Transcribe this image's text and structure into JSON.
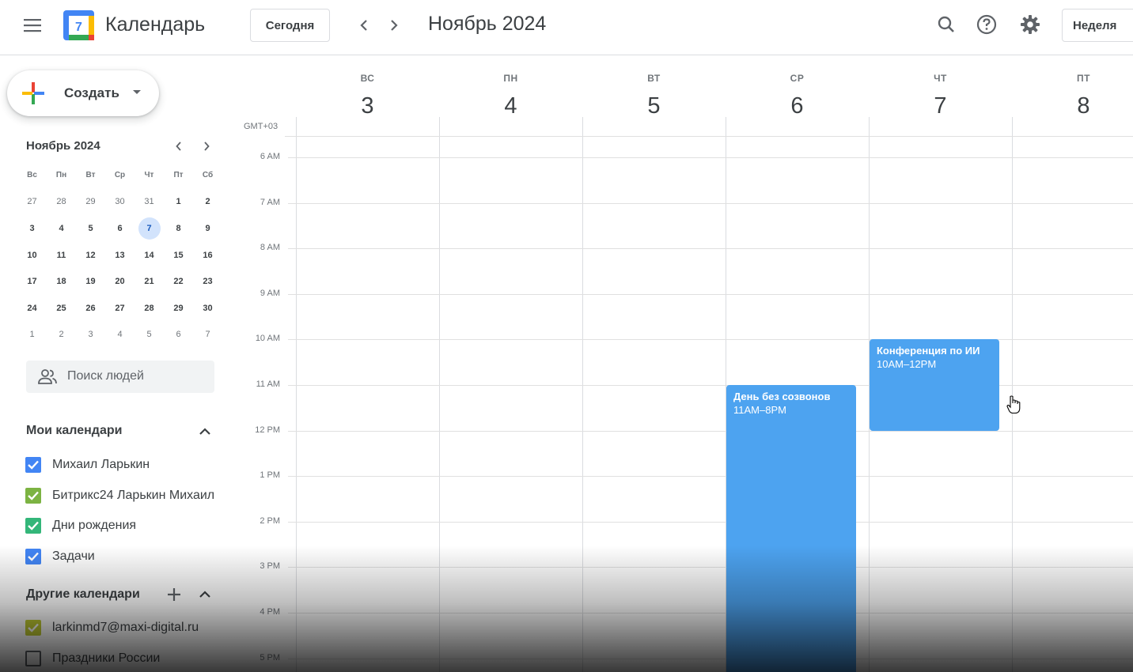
{
  "header": {
    "menu_icon": "hamburger-menu-icon",
    "app_title": "Календарь",
    "logo_day": "7",
    "today_label": "Сегодня",
    "current_period": "Ноябрь 2024",
    "view_label": "Неделя",
    "icons": [
      "search-icon",
      "help-icon",
      "gear-icon"
    ]
  },
  "sidebar": {
    "create_label": "Создать",
    "mini_calendar": {
      "title": "Ноябрь 2024",
      "weekdays": [
        "Вс",
        "Пн",
        "Вт",
        "Ср",
        "Чт",
        "Пт",
        "Сб"
      ],
      "weeks": [
        [
          "27",
          "28",
          "29",
          "30",
          "31",
          "1",
          "2"
        ],
        [
          "3",
          "4",
          "5",
          "6",
          "7",
          "8",
          "9"
        ],
        [
          "10",
          "11",
          "12",
          "13",
          "14",
          "15",
          "16"
        ],
        [
          "17",
          "18",
          "19",
          "20",
          "21",
          "22",
          "23"
        ],
        [
          "24",
          "25",
          "26",
          "27",
          "28",
          "29",
          "30"
        ],
        [
          "1",
          "2",
          "3",
          "4",
          "5",
          "6",
          "7"
        ]
      ],
      "selected_day": "7"
    },
    "people_search_placeholder": "Поиск людей",
    "my_calendars": {
      "title": "Мои календари",
      "items": [
        {
          "label": "Михаил Ларькин",
          "color": "#4285f4",
          "checked": true
        },
        {
          "label": "Битрикс24 Ларькин Михаил",
          "color": "#7cb342",
          "checked": true
        },
        {
          "label": "Дни рождения",
          "color": "#33b679",
          "checked": true
        },
        {
          "label": "Задачи",
          "color": "#4285f4",
          "checked": true
        }
      ]
    },
    "other_calendars": {
      "title": "Другие календари",
      "items": [
        {
          "label": "larkinmd7@maxi-digital.ru",
          "color": "#c0ca33",
          "checked": true
        },
        {
          "label": "Праздники России",
          "color": "#ffffff",
          "checked": false
        }
      ]
    }
  },
  "grid": {
    "timezone": "GMT+03",
    "days": [
      {
        "dow": "ВС",
        "num": "3"
      },
      {
        "dow": "ПН",
        "num": "4"
      },
      {
        "dow": "ВТ",
        "num": "5"
      },
      {
        "dow": "СР",
        "num": "6"
      },
      {
        "dow": "ЧТ",
        "num": "7"
      },
      {
        "dow": "ПТ",
        "num": "8"
      }
    ],
    "hours": [
      "6 AM",
      "7 AM",
      "8 AM",
      "9 AM",
      "10 AM",
      "11 AM",
      "12 PM",
      "1 PM",
      "2 PM",
      "3 PM",
      "4 PM",
      "5 PM"
    ],
    "events": [
      {
        "title": "День без созвонов",
        "time": "11AM–8PM",
        "day": "СР",
        "color": "#4da3f0"
      },
      {
        "title": "Конференция по ИИ",
        "time": "10AM–12PM",
        "day": "ЧТ",
        "color": "#4da3f0"
      }
    ]
  }
}
